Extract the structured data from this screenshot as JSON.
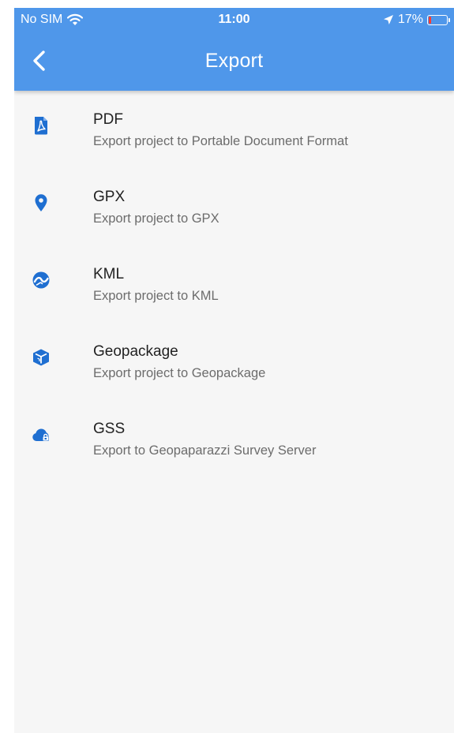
{
  "colors": {
    "appbar": "#4f97ea",
    "icon": "#1f6fd1",
    "background": "#f6f6f6",
    "battery_low": "#ff3b30"
  },
  "status_bar": {
    "carrier": "No SIM",
    "time": "11:00",
    "battery": "17%",
    "battery_level": 0.17,
    "icons": [
      "wifi-icon",
      "location-arrow-icon",
      "battery-icon"
    ]
  },
  "header": {
    "back_icon": "chevron-left-icon",
    "title": "Export"
  },
  "export_items": [
    {
      "icon": "pdf-file-icon",
      "label": "PDF",
      "description": "Export project to Portable Document Format"
    },
    {
      "icon": "map-pin-icon",
      "label": "GPX",
      "description": "Export project to GPX"
    },
    {
      "icon": "google-earth-icon",
      "label": "KML",
      "description": "Export project to KML"
    },
    {
      "icon": "cube-icon",
      "label": "Geopackage",
      "description": "Export project to Geopackage"
    },
    {
      "icon": "cloud-lock-icon",
      "label": "GSS",
      "description": "Export to Geopaparazzi Survey Server"
    }
  ]
}
